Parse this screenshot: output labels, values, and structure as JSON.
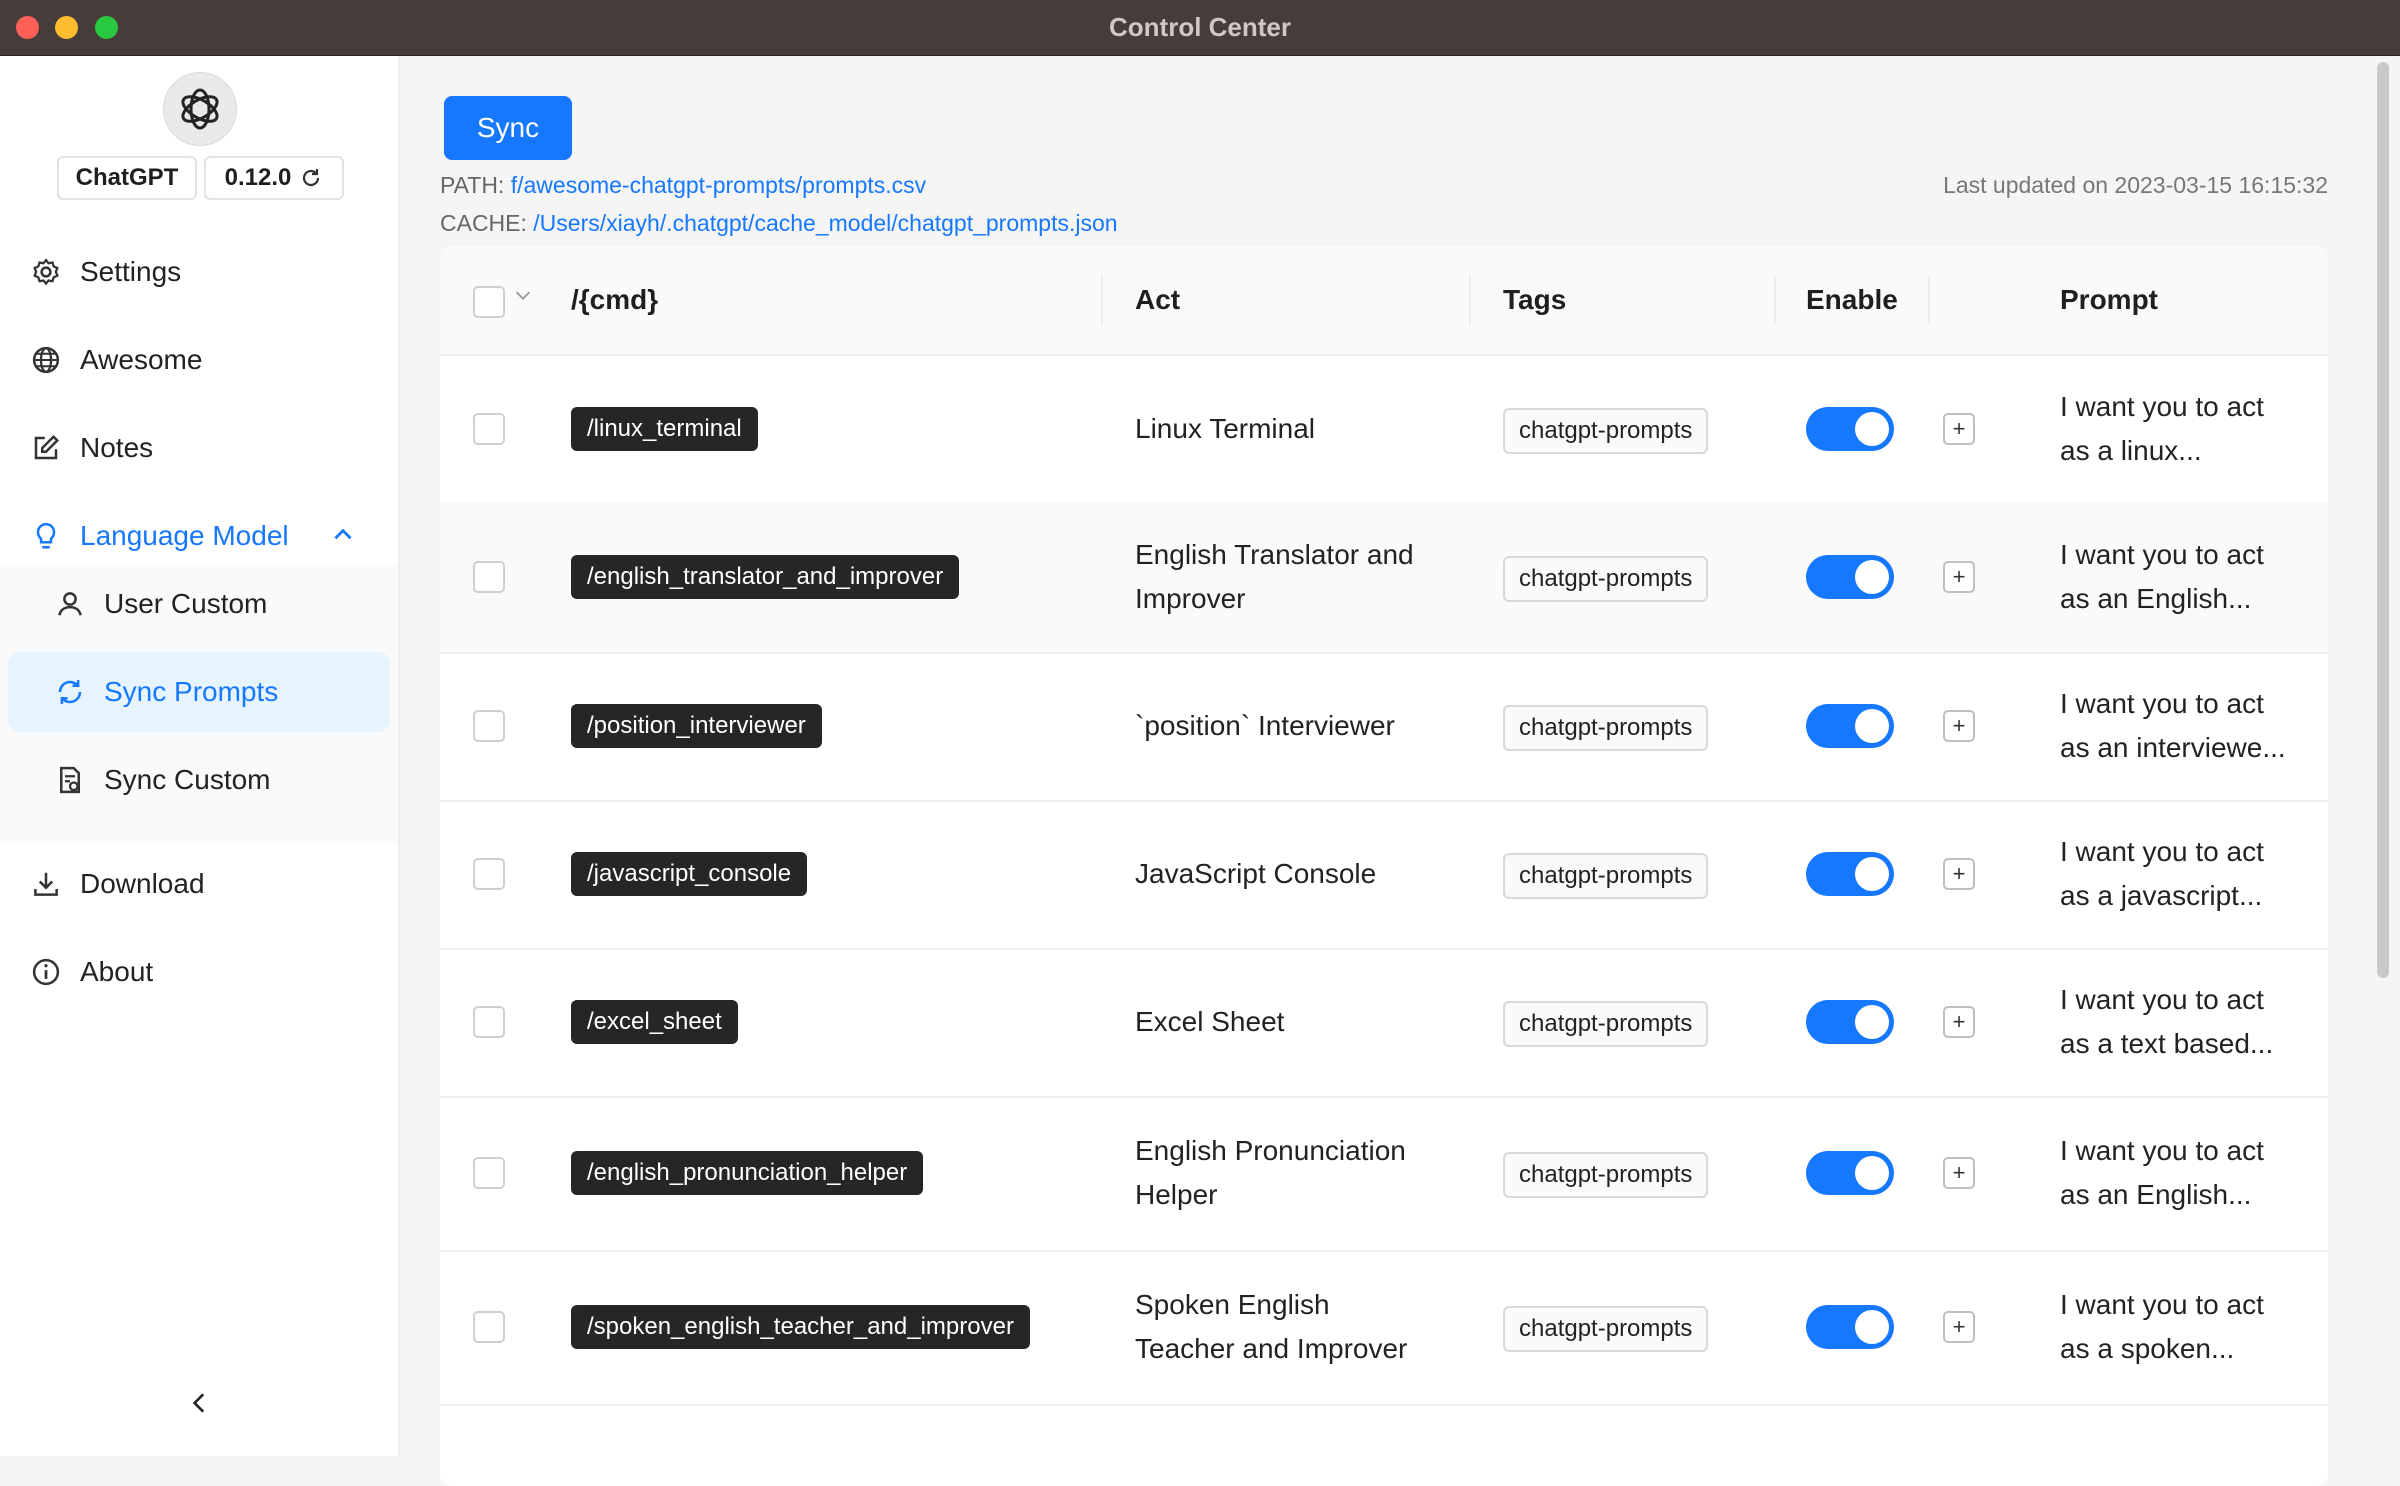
{
  "window": {
    "title": "Control Center"
  },
  "sidebar": {
    "app_name": "ChatGPT",
    "version": "0.12.0",
    "items": [
      {
        "label": "Settings",
        "icon": "gear-icon"
      },
      {
        "label": "Awesome",
        "icon": "globe-icon"
      },
      {
        "label": "Notes",
        "icon": "edit-icon"
      },
      {
        "label": "Language Model",
        "icon": "bulb-icon"
      }
    ],
    "submenu": [
      {
        "label": "User Custom",
        "icon": "user-icon"
      },
      {
        "label": "Sync Prompts",
        "icon": "sync-icon"
      },
      {
        "label": "Sync Custom",
        "icon": "file-sync-icon"
      }
    ],
    "bottom_items": [
      {
        "label": "Download",
        "icon": "download-icon"
      },
      {
        "label": "About",
        "icon": "info-icon"
      }
    ]
  },
  "main": {
    "sync_label": "Sync",
    "path_label": "PATH:",
    "path_value": "f/awesome-chatgpt-prompts/prompts.csv",
    "cache_label": "CACHE:",
    "cache_value": "/Users/xiayh/.chatgpt/cache_model/chatgpt_prompts.json",
    "last_updated": "Last updated on 2023-03-15 16:15:32"
  },
  "table": {
    "columns": {
      "cmd": "/{cmd}",
      "act": "Act",
      "tags": "Tags",
      "enable": "Enable",
      "prompt": "Prompt"
    },
    "rows": [
      {
        "cmd": "/linux_terminal",
        "act": "Linux Terminal",
        "tag": "chatgpt-prompts",
        "enabled": true,
        "prompt": "I want you to act as a linux..."
      },
      {
        "cmd": "/english_translator_and_improver",
        "act": "English Translator and Improver",
        "tag": "chatgpt-prompts",
        "enabled": true,
        "prompt": "I want you to act as an English..."
      },
      {
        "cmd": "/position_interviewer",
        "act": "`position` Interviewer",
        "tag": "chatgpt-prompts",
        "enabled": true,
        "prompt": "I want you to act as an interviewe..."
      },
      {
        "cmd": "/javascript_console",
        "act": "JavaScript Console",
        "tag": "chatgpt-prompts",
        "enabled": true,
        "prompt": "I want you to act as a javascript..."
      },
      {
        "cmd": "/excel_sheet",
        "act": "Excel Sheet",
        "tag": "chatgpt-prompts",
        "enabled": true,
        "prompt": "I want you to act as a text based..."
      },
      {
        "cmd": "/english_pronunciation_helper",
        "act": "English Pronunciation Helper",
        "tag": "chatgpt-prompts",
        "enabled": true,
        "prompt": "I want you to act as an English..."
      },
      {
        "cmd": "/spoken_english_teacher_and_improver",
        "act": "Spoken English Teacher and Improver",
        "tag": "chatgpt-prompts",
        "enabled": true,
        "prompt": "I want you to act as a spoken..."
      }
    ]
  }
}
